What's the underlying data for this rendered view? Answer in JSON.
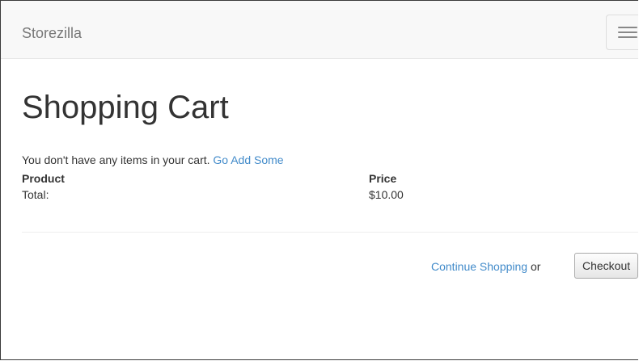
{
  "navbar": {
    "brand": "Storezilla",
    "toggle_icon": "hamburger-menu-icon"
  },
  "main": {
    "title": "Shopping Cart",
    "empty_message": "You don't have any items in your cart.",
    "empty_link": "Go Add Some",
    "table": {
      "headers": [
        "Product",
        "Price"
      ],
      "total_label": "Total:",
      "total_value": "$10.00"
    },
    "actions": {
      "continue_label": "Continue Shopping",
      "or_text": "or",
      "checkout_label": "Checkout"
    }
  },
  "colors": {
    "link": "#428bca",
    "navbar_bg": "#f8f8f8",
    "text": "#333333"
  }
}
